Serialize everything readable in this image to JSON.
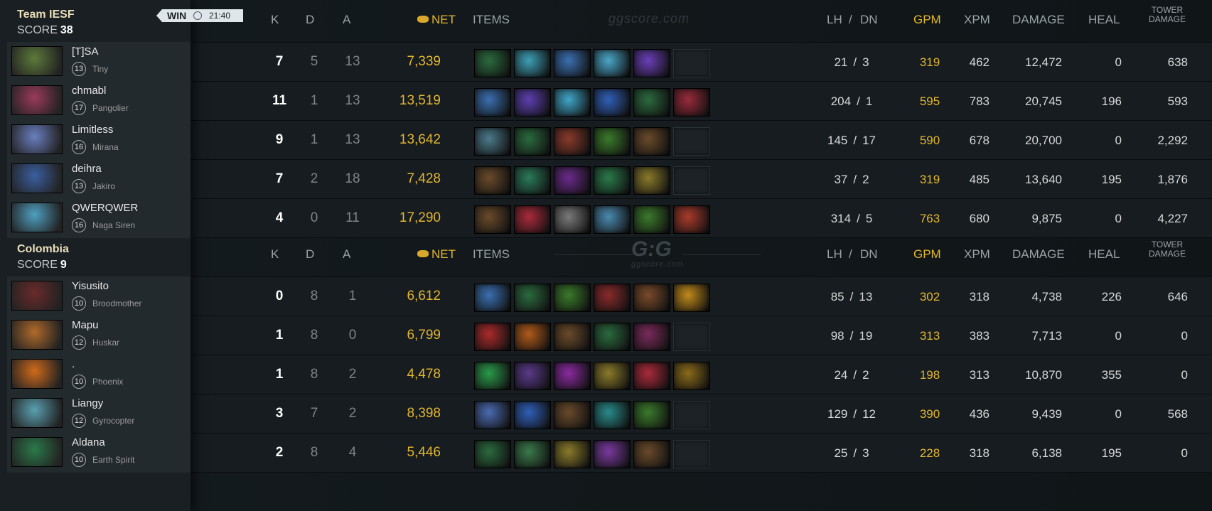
{
  "headers": {
    "k": "K",
    "d": "D",
    "a": "A",
    "net": "NET",
    "items": "ITEMS",
    "lh": "LH",
    "sep": "/",
    "dn": "DN",
    "gpm": "GPM",
    "xpm": "XPM",
    "damage": "DAMAGE",
    "heal": "HEAL",
    "tower1": "TOWER",
    "tower2": "DAMAGE"
  },
  "watermark": {
    "text": "ggscore.com",
    "logo": "G:G",
    "small": "ggscore.com"
  },
  "match": {
    "result": "WIN",
    "time": "21:40"
  },
  "teams": [
    {
      "name": "Team IESF",
      "score_label": "SCORE",
      "score": "38",
      "players": [
        {
          "name": "[T]SA",
          "level": "13",
          "hero": "Tiny",
          "k": "7",
          "d": "5",
          "a": "13",
          "net": "7,339",
          "lh": "21",
          "dn": "3",
          "gpm": "319",
          "xpm": "462",
          "damage": "12,472",
          "heal": "0",
          "tower": "638",
          "hero_color": "#5d7a3a",
          "items": [
            "#2a6a3e",
            "#3d9fb5",
            "#3a6fb0",
            "#4aa7c9",
            "#6a3fb8",
            "empty"
          ]
        },
        {
          "name": "chmabl",
          "level": "17",
          "hero": "Pangolier",
          "k": "11",
          "d": "1",
          "a": "13",
          "net": "13,519",
          "lh": "204",
          "dn": "1",
          "gpm": "595",
          "xpm": "783",
          "damage": "20,745",
          "heal": "196",
          "tower": "593",
          "hero_color": "#9b3a5a",
          "items": [
            "#3a6fb0",
            "#5d3fb0",
            "#3fa6c9",
            "#2f5fb8",
            "#2a6a3e",
            "#9a2a3a"
          ]
        },
        {
          "name": "Limitless",
          "level": "16",
          "hero": "Mirana",
          "k": "9",
          "d": "1",
          "a": "13",
          "net": "13,642",
          "lh": "145",
          "dn": "17",
          "gpm": "590",
          "xpm": "678",
          "damage": "20,700",
          "heal": "0",
          "tower": "2,292",
          "hero_color": "#6a7fc0",
          "items": [
            "#4a7a8a",
            "#2a6a3e",
            "#8a3a2a",
            "#3a7a2a",
            "#6a4a2a",
            "empty"
          ]
        },
        {
          "name": "deihra",
          "level": "13",
          "hero": "Jakiro",
          "k": "7",
          "d": "2",
          "a": "18",
          "net": "7,428",
          "lh": "37",
          "dn": "2",
          "gpm": "319",
          "xpm": "485",
          "damage": "13,640",
          "heal": "195",
          "tower": "1,876",
          "hero_color": "#3a5fa0",
          "items": [
            "#6a4a2a",
            "#2a7a5a",
            "#6a2a8a",
            "#2a7a4a",
            "#8a7a2a",
            "empty"
          ]
        },
        {
          "name": "QWERQWER",
          "level": "16",
          "hero": "Naga Siren",
          "k": "4",
          "d": "0",
          "a": "11",
          "net": "17,290",
          "lh": "314",
          "dn": "5",
          "gpm": "763",
          "xpm": "680",
          "damage": "9,875",
          "heal": "0",
          "tower": "4,227",
          "hero_color": "#4fa0c0",
          "items": [
            "#6a4a2a",
            "#aa2a3a",
            "#7a7a7a",
            "#4a8ab0",
            "#3a7a2a",
            "#aa3a2a"
          ]
        }
      ]
    },
    {
      "name": "Colombia",
      "score_label": "SCORE",
      "score": "9",
      "players": [
        {
          "name": "Yisusito",
          "level": "10",
          "hero": "Broodmother",
          "k": "0",
          "d": "8",
          "a": "1",
          "net": "6,612",
          "lh": "85",
          "dn": "13",
          "gpm": "302",
          "xpm": "318",
          "damage": "4,738",
          "heal": "226",
          "tower": "646",
          "hero_color": "#6a2a2a",
          "items": [
            "#3a6fb0",
            "#2a6a3e",
            "#3a7a2a",
            "#8a2a2a",
            "#7a4a2a",
            "#c08a1a"
          ]
        },
        {
          "name": "Mapu",
          "level": "12",
          "hero": "Huskar",
          "k": "1",
          "d": "8",
          "a": "0",
          "net": "6,799",
          "lh": "98",
          "dn": "19",
          "gpm": "313",
          "xpm": "383",
          "damage": "7,713",
          "heal": "0",
          "tower": "0",
          "hero_color": "#b06a2a",
          "items": [
            "#aa2a2a",
            "#b05a1a",
            "#6a4a2a",
            "#2a6a3e",
            "#7a2a5a",
            "empty"
          ]
        },
        {
          "name": ".",
          "level": "10",
          "hero": "Phoenix",
          "k": "1",
          "d": "8",
          "a": "2",
          "net": "4,478",
          "lh": "24",
          "dn": "2",
          "gpm": "198",
          "xpm": "313",
          "damage": "10,870",
          "heal": "355",
          "tower": "0",
          "hero_color": "#d06a1a",
          "items": [
            "#2a9a4a",
            "#5a3a8a",
            "#8a2aa0",
            "#8a7a2a",
            "#aa2a3a",
            "#8a6a1a"
          ]
        },
        {
          "name": "Liangy",
          "level": "12",
          "hero": "Gyrocopter",
          "k": "3",
          "d": "7",
          "a": "2",
          "net": "8,398",
          "lh": "129",
          "dn": "12",
          "gpm": "390",
          "xpm": "436",
          "damage": "9,439",
          "heal": "0",
          "tower": "568",
          "hero_color": "#5aa0b0",
          "items": [
            "#4a6ab0",
            "#2f5fb8",
            "#6a4a2a",
            "#2a8a8a",
            "#3a7a2a",
            "empty"
          ]
        },
        {
          "name": "Aldana",
          "level": "10",
          "hero": "Earth Spirit",
          "k": "2",
          "d": "8",
          "a": "4",
          "net": "5,446",
          "lh": "25",
          "dn": "3",
          "gpm": "228",
          "xpm": "318",
          "damage": "6,138",
          "heal": "195",
          "tower": "0",
          "hero_color": "#2a7a4a",
          "items": [
            "#2a6a3e",
            "#3a7a4a",
            "#8a7a2a",
            "#7a3aa0",
            "#6a4a2a",
            "empty"
          ]
        }
      ]
    }
  ]
}
